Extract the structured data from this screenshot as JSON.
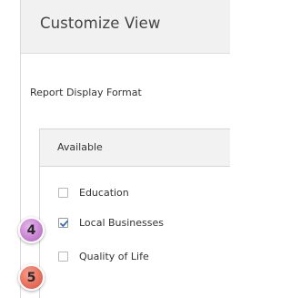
{
  "header": {
    "title": "Customize View"
  },
  "section": {
    "label": "Report Display Format"
  },
  "panel": {
    "header_label": "Available",
    "options": [
      {
        "label": "Education",
        "checked": false
      },
      {
        "label": "Local Businesses",
        "checked": true
      },
      {
        "label": "Quality of Life",
        "checked": false
      }
    ]
  },
  "markers": [
    {
      "number": "4",
      "color": "#c986d3"
    },
    {
      "number": "5",
      "color": "#e9705c"
    }
  ],
  "colors": {
    "header_bg": "#f1f1f1",
    "check_blue": "#2f6fb5"
  }
}
